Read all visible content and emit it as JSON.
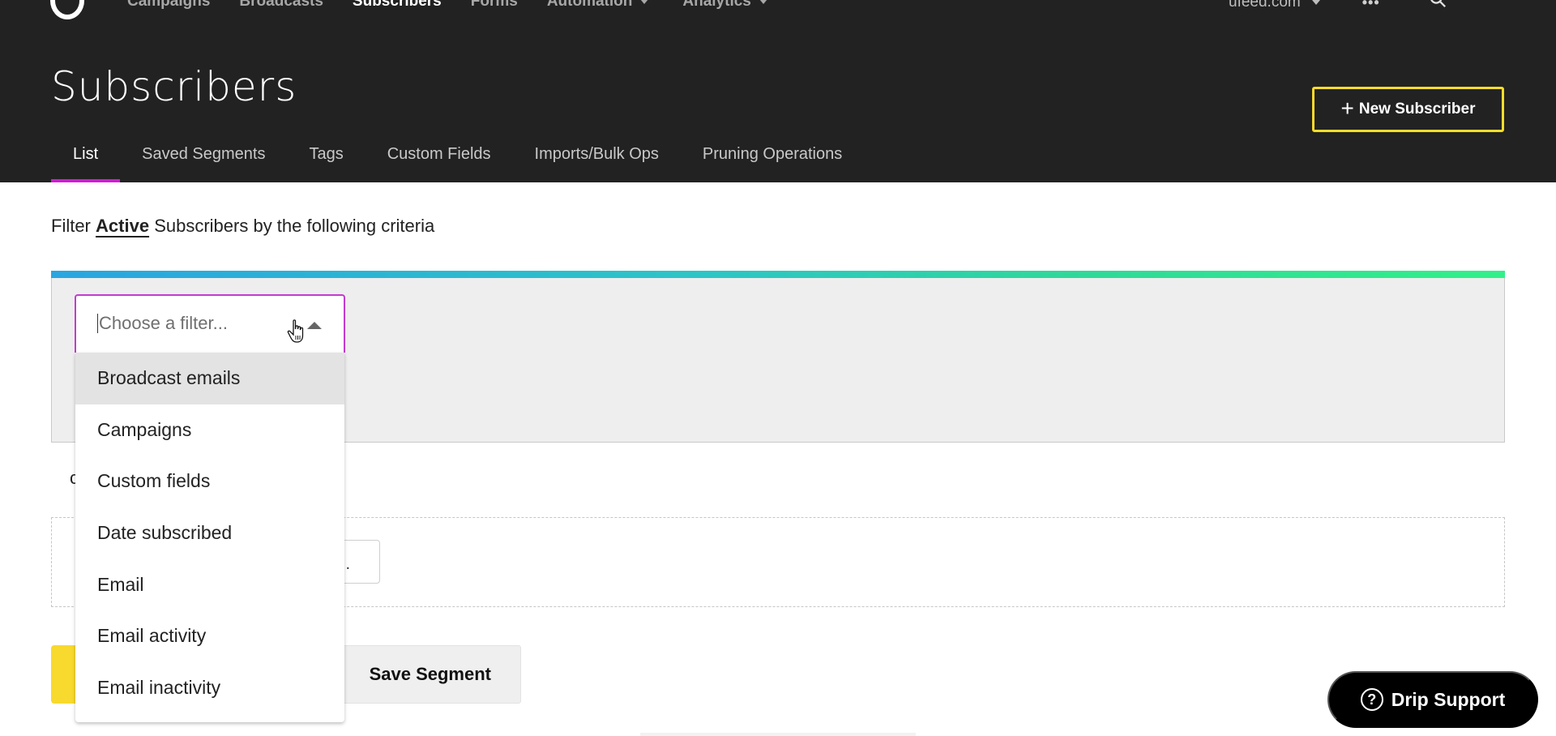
{
  "topnav": {
    "items": [
      {
        "label": "Campaigns",
        "active": false,
        "has_caret": false
      },
      {
        "label": "Broadcasts",
        "active": false,
        "has_caret": false
      },
      {
        "label": "Subscribers",
        "active": true,
        "has_caret": false
      },
      {
        "label": "Forms",
        "active": false,
        "has_caret": false
      },
      {
        "label": "Automation",
        "active": false,
        "has_caret": true
      },
      {
        "label": "Analytics",
        "active": false,
        "has_caret": true
      }
    ],
    "account_label": "ufeed.com",
    "more_icon": "dots-icon",
    "search_icon": "search-icon"
  },
  "header": {
    "title": "Subscribers",
    "new_subscriber_label": "New Subscriber",
    "new_subscriber_icon": "plus-icon"
  },
  "tabs": [
    {
      "label": "List",
      "active": true
    },
    {
      "label": "Saved Segments",
      "active": false
    },
    {
      "label": "Tags",
      "active": false
    },
    {
      "label": "Custom Fields",
      "active": false
    },
    {
      "label": "Imports/Bulk Ops",
      "active": false
    },
    {
      "label": "Pruning Operations",
      "active": false
    }
  ],
  "filter": {
    "prefix": "Filter",
    "status": "Active",
    "suffix": "Subscribers by the following criteria",
    "select_placeholder": "Choose a filter...",
    "options": [
      {
        "label": "Broadcast emails",
        "highlighted": true
      },
      {
        "label": "Campaigns",
        "highlighted": false
      },
      {
        "label": "Custom fields",
        "highlighted": false
      },
      {
        "label": "Date subscribed",
        "highlighted": false
      },
      {
        "label": "Email",
        "highlighted": false
      },
      {
        "label": "Email activity",
        "highlighted": false
      },
      {
        "label": "Email inactivity",
        "highlighted": false
      }
    ]
  },
  "behind_dropdown": {
    "partial_letter": "c",
    "input_partial_text": "."
  },
  "actions": {
    "save_segment_label": "Save Segment"
  },
  "support": {
    "label": "Drip Support",
    "icon": "question-icon"
  },
  "colors": {
    "header_bg": "#222222",
    "accent_magenta": "#d01bd5",
    "accent_yellow": "#f8d92e",
    "gradient_start": "#2aa5e0",
    "gradient_end": "#31f08a"
  }
}
